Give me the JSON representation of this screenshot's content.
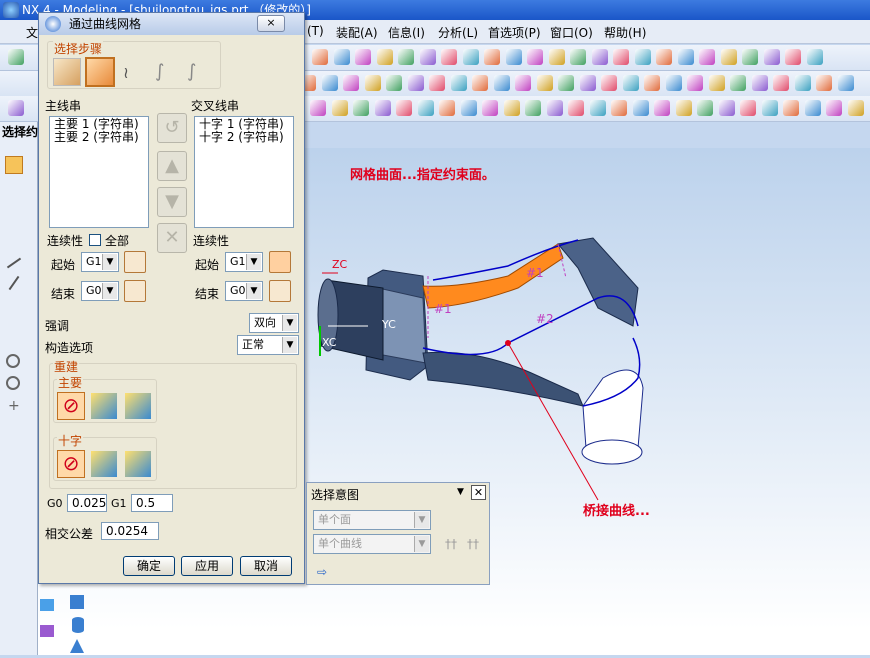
{
  "window": {
    "title": "NX 4 - Modeling - [shuilongtou_igs.prt （修改的）]"
  },
  "menu": {
    "items": [
      "文",
      "(T)",
      "装配(A)",
      "信息(I)",
      "分析(L)",
      "首选项(P)",
      "窗口(O)",
      "帮助(H)"
    ]
  },
  "left_panel": {
    "title": "选择约"
  },
  "dialog": {
    "title": "通过曲线网格",
    "steps_label": "选择步骤",
    "primary": {
      "label": "主线串",
      "items": [
        "主要 1 (字符串)",
        "主要 2 (字符串)"
      ]
    },
    "cross": {
      "label": "交叉线串",
      "items": [
        "十字 1 (字符串)",
        "十字 2 (字符串)"
      ]
    },
    "continuity_label": "连续性",
    "all_label": "全部",
    "start_label": "起始",
    "end_label": "结束",
    "primary_start": "G1",
    "primary_end": "G0",
    "cross_start": "G1",
    "cross_end": "G0",
    "emphasis_label": "强调",
    "emphasis_value": "双向",
    "build_label": "构造选项",
    "build_value": "正常",
    "rebuild_label": "重建",
    "rebuild_primary_label": "主要",
    "rebuild_cross_label": "十字",
    "g0_label": "G0",
    "g0_value": "0.025",
    "g1_label": "G1",
    "g1_value": "0.5",
    "tol_label": "相交公差",
    "tol_value": "0.0254",
    "ok": "确定",
    "apply": "应用",
    "cancel": "取消"
  },
  "select_intent": {
    "title": "选择意图",
    "face_placeholder": "单个面",
    "curve_placeholder": "单个曲线"
  },
  "annotations": {
    "mesh_note": "网格曲面...指定约束面。",
    "bridge_note": "桥接曲线..."
  },
  "viewport": {
    "axis_zc": "ZC",
    "axis_yc": "YC",
    "axis_xc": "XC",
    "marker_1a": "#1",
    "marker_1b": "#1",
    "marker_2": "#2"
  },
  "colors": {
    "accent": "#e0001c",
    "surface": "#3e5478",
    "curve": "#0000c8",
    "highlight": "#ff8a1e"
  }
}
